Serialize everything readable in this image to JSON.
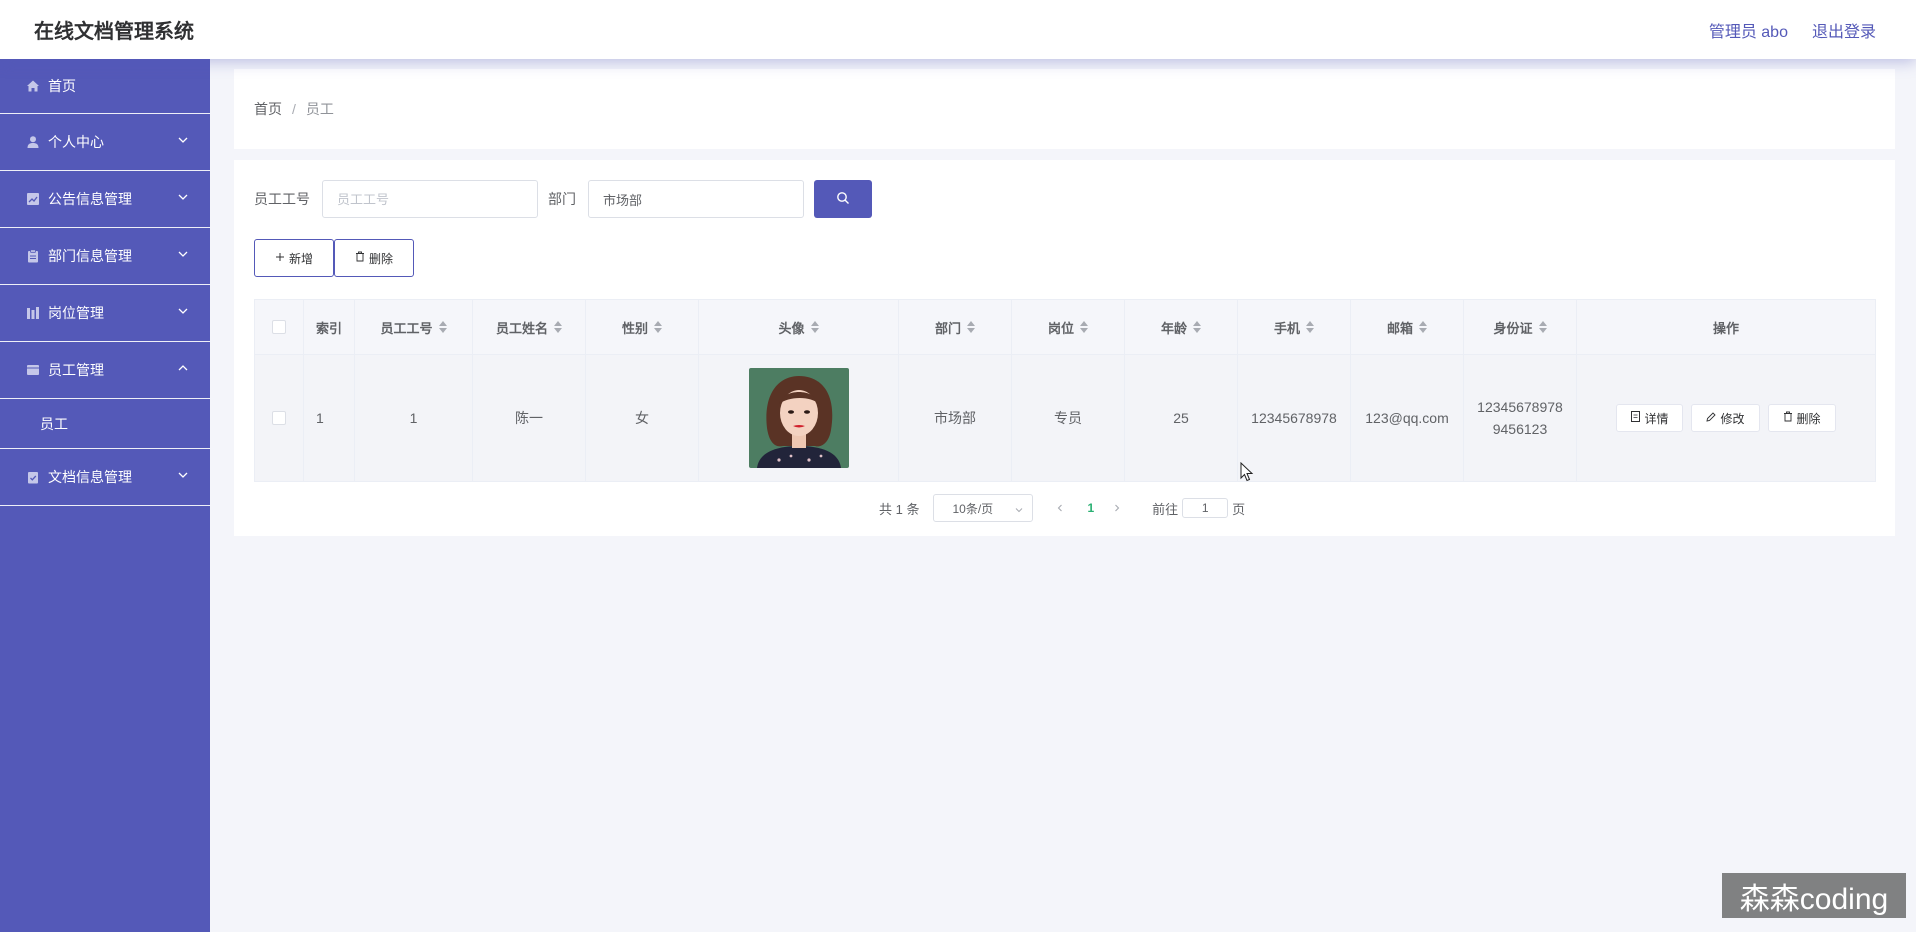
{
  "app": {
    "title": "在线文档管理系统",
    "user_label": "管理员 abo",
    "logout": "退出登录"
  },
  "colors": {
    "accent": "#5459b8",
    "page_bg": "#f4f5fa",
    "active_page": "#2ab073"
  },
  "sidebar": {
    "items": [
      {
        "label": "首页",
        "icon": "home-icon"
      },
      {
        "label": "个人中心",
        "icon": "user-icon"
      },
      {
        "label": "公告信息管理",
        "icon": "chart-icon"
      },
      {
        "label": "部门信息管理",
        "icon": "clipboard-icon"
      },
      {
        "label": "岗位管理",
        "icon": "bars-icon"
      },
      {
        "label": "员工管理",
        "icon": "folder-icon",
        "expanded": true
      },
      {
        "label": "文档信息管理",
        "icon": "check-clipboard-icon"
      }
    ],
    "submenu": {
      "label": "员工"
    }
  },
  "breadcrumb": {
    "home": "首页",
    "sep": "/",
    "current": "员工"
  },
  "search": {
    "id_label": "员工工号",
    "id_placeholder": "员工工号",
    "id_value": "",
    "dept_label": "部门",
    "dept_value": "市场部"
  },
  "actions": {
    "add": "新增",
    "delete": "删除"
  },
  "table": {
    "headers": [
      "索引",
      "员工工号",
      "员工姓名",
      "性别",
      "头像",
      "部门",
      "岗位",
      "年龄",
      "手机",
      "邮箱",
      "身份证",
      "操作"
    ],
    "rows": [
      {
        "index": "1",
        "emp_id": "1",
        "name": "陈一",
        "gender": "女",
        "avatar": "portrait-photo",
        "dept": "市场部",
        "position": "专员",
        "age": "25",
        "phone": "12345678978",
        "email": "123@qq.com",
        "idcard_line1": "12345678978",
        "idcard_line2": "9456123"
      }
    ],
    "row_ops": {
      "detail": "详情",
      "edit": "修改",
      "delete": "删除"
    }
  },
  "pagination": {
    "total": "共 1 条",
    "page_size": "10条/页",
    "current": "1",
    "goto_label": "前往",
    "goto_value": "1",
    "page_suffix": "页"
  },
  "watermark": "森森coding"
}
